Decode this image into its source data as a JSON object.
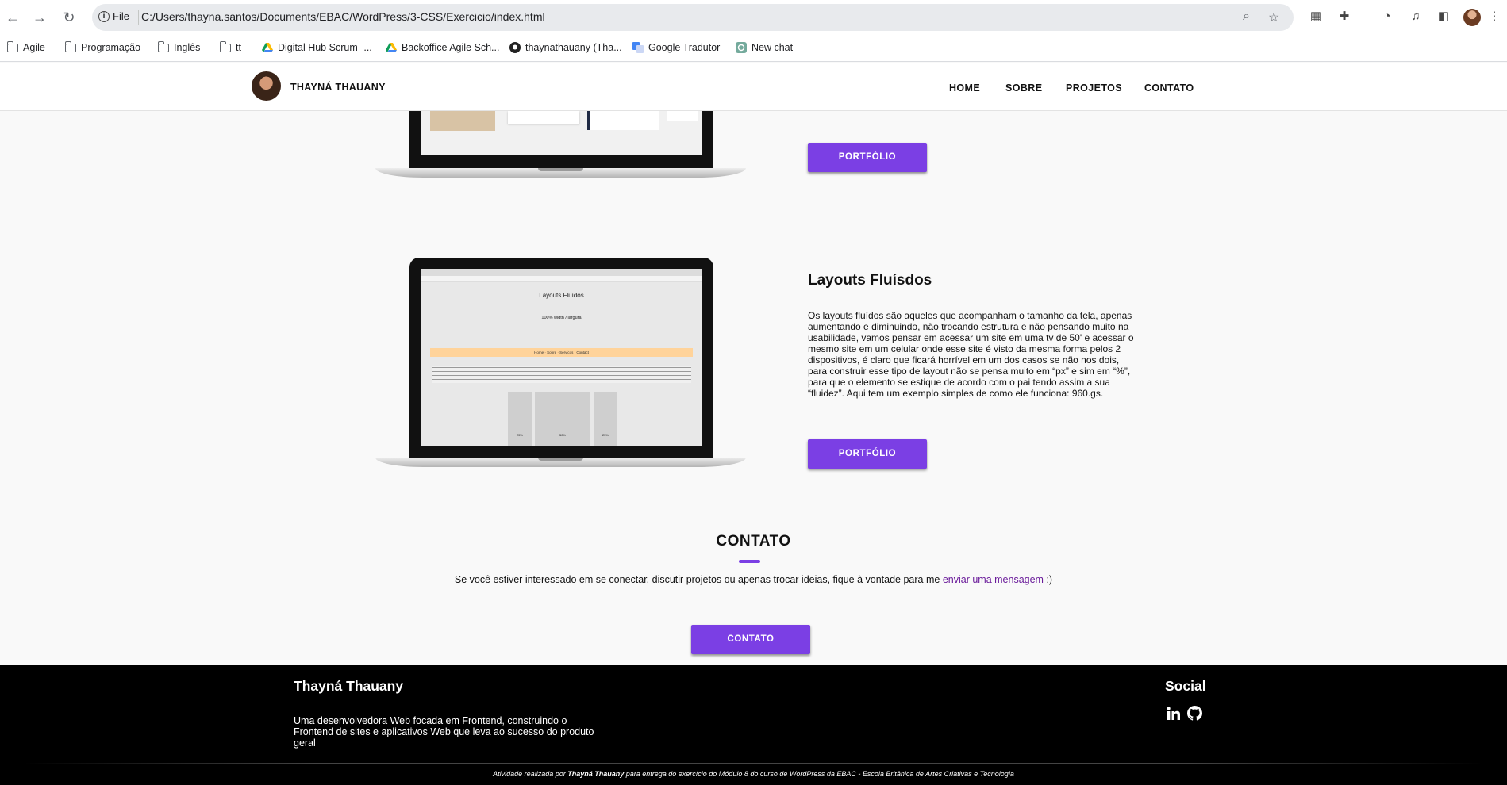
{
  "browser": {
    "url_scheme_label": "File",
    "url": "C:/Users/thayna.santos/Documents/EBAC/WordPress/3-CSS/Exercicio/index.html",
    "bookmarks": [
      {
        "label": "Agile",
        "icon": "folder-icon"
      },
      {
        "label": "Programação",
        "icon": "folder-icon"
      },
      {
        "label": "Inglês",
        "icon": "folder-icon"
      },
      {
        "label": "tt",
        "icon": "folder-icon"
      },
      {
        "label": "Digital Hub Scrum -...",
        "icon": "drive-icon"
      },
      {
        "label": "Backoffice Agile Sch...",
        "icon": "drive-icon"
      },
      {
        "label": "thaynathauany (Tha...",
        "icon": "github-icon"
      },
      {
        "label": "Google Tradutor",
        "icon": "translate-icon"
      },
      {
        "label": "New chat",
        "icon": "chatgpt-icon"
      }
    ]
  },
  "site": {
    "logo_text": "THAYNÁ THAUANY",
    "nav": [
      "HOME",
      "SOBRE",
      "PROJETOS",
      "CONTATO"
    ]
  },
  "projects": {
    "first": {
      "button_label": "PORTFÓLIO"
    },
    "second": {
      "title": "Layouts Fluísdos",
      "description": "Os layouts fluídos são aqueles que acompanham o tamanho da tela, apenas aumentando e diminuindo, não trocando estrutura e não pensando muito na usabilidade, vamos pensar em acessar um site em uma tv de 50' e acessar o mesmo site em um celular onde esse site é visto da mesma forma pelos 2 dispositivos, é claro que ficará horrível em um dos casos se não nos dois, para construir esse tipo de layout não se pensa muito em “px” e sim em “%”, para que o elemento se estique de acordo com o pai tendo assim a sua “fluidez”. Aqui tem um exemplo simples de como ele funciona: 960.gs.",
      "button_label": "PORTFÓLIO",
      "screenshot": {
        "title": "Layouts Fluídos",
        "subtitle": "100% width / largura",
        "nav": "Home · Sobre · Serviços · Contact",
        "columns": [
          "25%",
          "50%",
          "25%"
        ]
      }
    }
  },
  "contato": {
    "title": "CONTATO",
    "text_before": "Se você estiver interessado em se conectar, discutir projetos ou apenas trocar ideias, fique à vontade para me ",
    "link": "enviar uma mensagem",
    "text_after": " :)",
    "button_label": "CONTATO"
  },
  "footer": {
    "name": "Thayná Thauany",
    "description": "Uma desenvolvedora Web focada em Frontend, construindo o Frontend de sites e aplicativos Web que leva ao sucesso do produto geral",
    "social_title": "Social",
    "social_icons": [
      "linkedin-icon",
      "github-icon"
    ],
    "credit_prefix": "Atividade realizada por ",
    "credit_name": "Thayná Thauany",
    "credit_suffix": " para entrega do exercício do Módulo 8 do curso de WordPress da EBAC - Escola Britânica de Artes Criativas e Tecnologia"
  },
  "colors": {
    "accent": "#7b3fe4",
    "footer_bg": "#000000",
    "page_bg": "#f9f9f9"
  }
}
